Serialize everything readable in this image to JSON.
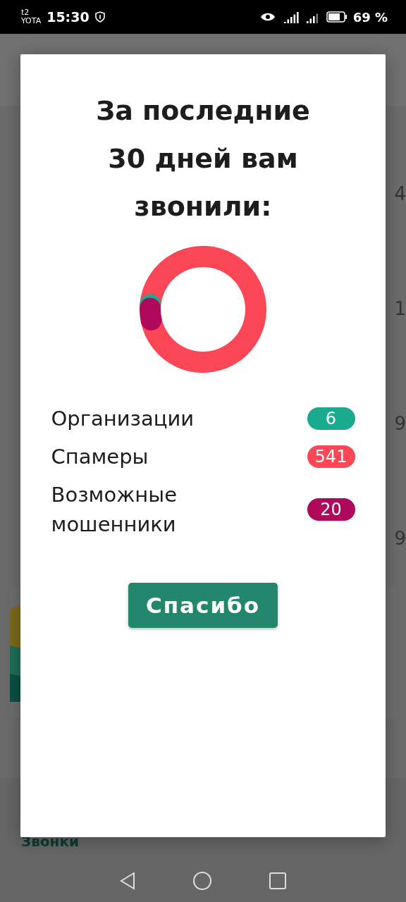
{
  "status_bar": {
    "carrier_top": "t2",
    "carrier_bottom": "YOTA",
    "time": "15:30",
    "battery": "69 %"
  },
  "background": {
    "row_values": [
      "4",
      "1",
      "9",
      "9"
    ],
    "bottom_tab": "Звонки"
  },
  "dialog": {
    "title": "За последние\n30 дней вам\nзвонили:",
    "categories": [
      {
        "label": "Организации",
        "count": "6",
        "color": "#1aaa8f"
      },
      {
        "label": "Спамеры",
        "count": "541",
        "color": "#fc4757"
      },
      {
        "label": "Возможные\nмошенники",
        "count": "20",
        "color": "#b0085a"
      }
    ],
    "button": "Спасибо"
  }
}
